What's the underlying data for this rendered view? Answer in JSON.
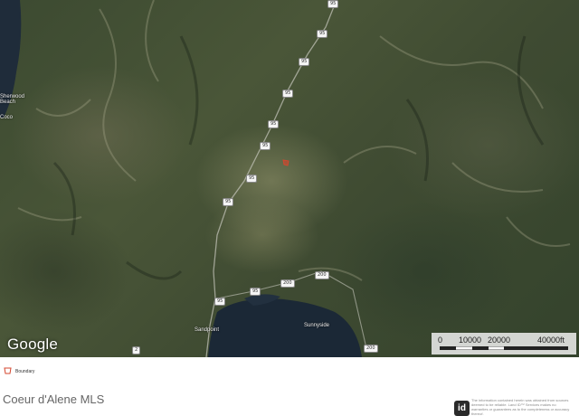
{
  "map": {
    "attribution_logo": "Google",
    "scale": {
      "labels": [
        "0",
        "10000",
        "20000",
        "40000ft"
      ]
    },
    "route_shields": [
      "95",
      "95",
      "95",
      "95",
      "95",
      "95",
      "95",
      "95",
      "95",
      "200",
      "200",
      "200",
      "2",
      "95"
    ],
    "places": [
      "Sherwood Beach",
      "Coco",
      "Sandpoint",
      "Sunnyside"
    ]
  },
  "legend": {
    "items": [
      {
        "label": "Boundary",
        "color": "#d4472f",
        "icon": "boundary-polygon-icon"
      }
    ]
  },
  "footer": {
    "brand": "Coeur d'Alene MLS",
    "logo_text": "id",
    "logo_icon": "idx-logo-icon",
    "disclaimer": "The information contained herein was obtained from sources deemed to be reliable. Land ID™ Services makes no warranties or guarantees as to the completeness or accuracy thereof."
  }
}
